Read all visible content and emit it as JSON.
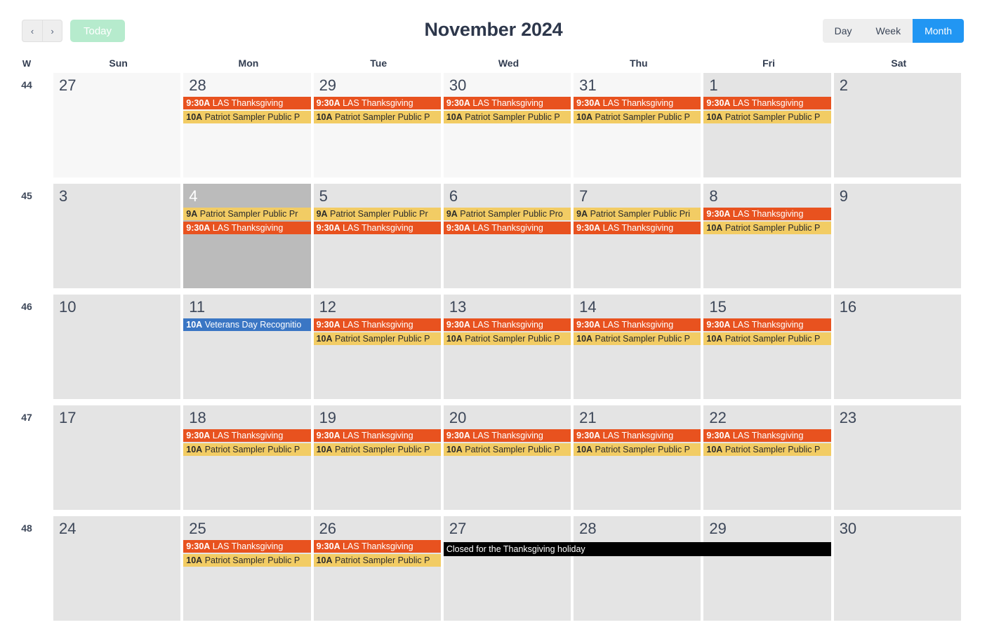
{
  "toolbar": {
    "prev_icon": "chevron-left-icon",
    "prev_label": "‹",
    "next_icon": "chevron-right-icon",
    "next_label": "›",
    "today_label": "Today",
    "title": "November 2024",
    "views": [
      {
        "label": "Day",
        "active": false
      },
      {
        "label": "Week",
        "active": false
      },
      {
        "label": "Month",
        "active": true
      }
    ]
  },
  "colors": {
    "accent_blue": "#2196f3",
    "today_green": "#b6ebcd",
    "event_orange": "#e8521f",
    "event_amber": "#f2cc64",
    "event_blue": "#3a76c4",
    "banner_black": "#000000",
    "cell_current": "#e4e4e4",
    "cell_other": "#f7f7f7",
    "cell_today": "#bbbbbb"
  },
  "header": {
    "week_col_label": "W",
    "days": [
      "Sun",
      "Mon",
      "Tue",
      "Wed",
      "Thu",
      "Fri",
      "Sat"
    ]
  },
  "weeks": [
    {
      "week_number": "44",
      "days": [
        {
          "num": "27",
          "other_month": true,
          "today": false,
          "events": []
        },
        {
          "num": "28",
          "other_month": true,
          "today": false,
          "events": [
            {
              "time": "9:30A",
              "title": "LAS Thanksgiving",
              "color": "orange"
            },
            {
              "time": "10A",
              "title": "Patriot Sampler Public P",
              "color": "amber"
            }
          ]
        },
        {
          "num": "29",
          "other_month": true,
          "today": false,
          "events": [
            {
              "time": "9:30A",
              "title": "LAS Thanksgiving",
              "color": "orange"
            },
            {
              "time": "10A",
              "title": "Patriot Sampler Public P",
              "color": "amber"
            }
          ]
        },
        {
          "num": "30",
          "other_month": true,
          "today": false,
          "events": [
            {
              "time": "9:30A",
              "title": "LAS Thanksgiving",
              "color": "orange"
            },
            {
              "time": "10A",
              "title": "Patriot Sampler Public P",
              "color": "amber"
            }
          ]
        },
        {
          "num": "31",
          "other_month": true,
          "today": false,
          "events": [
            {
              "time": "9:30A",
              "title": "LAS Thanksgiving",
              "color": "orange"
            },
            {
              "time": "10A",
              "title": "Patriot Sampler Public P",
              "color": "amber"
            }
          ]
        },
        {
          "num": "1",
          "other_month": false,
          "today": false,
          "events": [
            {
              "time": "9:30A",
              "title": "LAS Thanksgiving",
              "color": "orange"
            },
            {
              "time": "10A",
              "title": "Patriot Sampler Public P",
              "color": "amber"
            }
          ]
        },
        {
          "num": "2",
          "other_month": false,
          "today": false,
          "events": []
        }
      ]
    },
    {
      "week_number": "45",
      "days": [
        {
          "num": "3",
          "other_month": false,
          "today": false,
          "events": []
        },
        {
          "num": "4",
          "other_month": false,
          "today": true,
          "events": [
            {
              "time": "9A",
              "title": "Patriot Sampler Public Pr",
              "color": "amber"
            },
            {
              "time": "9:30A",
              "title": "LAS Thanksgiving",
              "color": "orange"
            }
          ]
        },
        {
          "num": "5",
          "other_month": false,
          "today": false,
          "events": [
            {
              "time": "9A",
              "title": "Patriot Sampler Public Pr",
              "color": "amber"
            },
            {
              "time": "9:30A",
              "title": "LAS Thanksgiving",
              "color": "orange"
            }
          ]
        },
        {
          "num": "6",
          "other_month": false,
          "today": false,
          "events": [
            {
              "time": "9A",
              "title": "Patriot Sampler Public Pro",
              "color": "amber"
            },
            {
              "time": "9:30A",
              "title": "LAS Thanksgiving",
              "color": "orange"
            }
          ]
        },
        {
          "num": "7",
          "other_month": false,
          "today": false,
          "events": [
            {
              "time": "9A",
              "title": "Patriot Sampler Public Pri",
              "color": "amber"
            },
            {
              "time": "9:30A",
              "title": "LAS Thanksgiving",
              "color": "orange"
            }
          ]
        },
        {
          "num": "8",
          "other_month": false,
          "today": false,
          "events": [
            {
              "time": "9:30A",
              "title": "LAS Thanksgiving",
              "color": "orange"
            },
            {
              "time": "10A",
              "title": "Patriot Sampler Public P",
              "color": "amber"
            }
          ]
        },
        {
          "num": "9",
          "other_month": false,
          "today": false,
          "events": []
        }
      ]
    },
    {
      "week_number": "46",
      "days": [
        {
          "num": "10",
          "other_month": false,
          "today": false,
          "events": []
        },
        {
          "num": "11",
          "other_month": false,
          "today": false,
          "events": [
            {
              "time": "10A",
              "title": "Veterans Day Recognitio",
              "color": "blue"
            }
          ]
        },
        {
          "num": "12",
          "other_month": false,
          "today": false,
          "events": [
            {
              "time": "9:30A",
              "title": "LAS Thanksgiving",
              "color": "orange"
            },
            {
              "time": "10A",
              "title": "Patriot Sampler Public P",
              "color": "amber"
            }
          ]
        },
        {
          "num": "13",
          "other_month": false,
          "today": false,
          "events": [
            {
              "time": "9:30A",
              "title": "LAS Thanksgiving",
              "color": "orange"
            },
            {
              "time": "10A",
              "title": "Patriot Sampler Public P",
              "color": "amber"
            }
          ]
        },
        {
          "num": "14",
          "other_month": false,
          "today": false,
          "events": [
            {
              "time": "9:30A",
              "title": "LAS Thanksgiving",
              "color": "orange"
            },
            {
              "time": "10A",
              "title": "Patriot Sampler Public P",
              "color": "amber"
            }
          ]
        },
        {
          "num": "15",
          "other_month": false,
          "today": false,
          "events": [
            {
              "time": "9:30A",
              "title": "LAS Thanksgiving",
              "color": "orange"
            },
            {
              "time": "10A",
              "title": "Patriot Sampler Public P",
              "color": "amber"
            }
          ]
        },
        {
          "num": "16",
          "other_month": false,
          "today": false,
          "events": []
        }
      ]
    },
    {
      "week_number": "47",
      "days": [
        {
          "num": "17",
          "other_month": false,
          "today": false,
          "events": []
        },
        {
          "num": "18",
          "other_month": false,
          "today": false,
          "events": [
            {
              "time": "9:30A",
              "title": "LAS Thanksgiving",
              "color": "orange"
            },
            {
              "time": "10A",
              "title": "Patriot Sampler Public P",
              "color": "amber"
            }
          ]
        },
        {
          "num": "19",
          "other_month": false,
          "today": false,
          "events": [
            {
              "time": "9:30A",
              "title": "LAS Thanksgiving",
              "color": "orange"
            },
            {
              "time": "10A",
              "title": "Patriot Sampler Public P",
              "color": "amber"
            }
          ]
        },
        {
          "num": "20",
          "other_month": false,
          "today": false,
          "events": [
            {
              "time": "9:30A",
              "title": "LAS Thanksgiving",
              "color": "orange"
            },
            {
              "time": "10A",
              "title": "Patriot Sampler Public P",
              "color": "amber"
            }
          ]
        },
        {
          "num": "21",
          "other_month": false,
          "today": false,
          "events": [
            {
              "time": "9:30A",
              "title": "LAS Thanksgiving",
              "color": "orange"
            },
            {
              "time": "10A",
              "title": "Patriot Sampler Public P",
              "color": "amber"
            }
          ]
        },
        {
          "num": "22",
          "other_month": false,
          "today": false,
          "events": [
            {
              "time": "9:30A",
              "title": "LAS Thanksgiving",
              "color": "orange"
            },
            {
              "time": "10A",
              "title": "Patriot Sampler Public P",
              "color": "amber"
            }
          ]
        },
        {
          "num": "23",
          "other_month": false,
          "today": false,
          "events": []
        }
      ]
    },
    {
      "week_number": "48",
      "days": [
        {
          "num": "24",
          "other_month": false,
          "today": false,
          "events": []
        },
        {
          "num": "25",
          "other_month": false,
          "today": false,
          "events": [
            {
              "time": "9:30A",
              "title": "LAS Thanksgiving",
              "color": "orange"
            },
            {
              "time": "10A",
              "title": "Patriot Sampler Public P",
              "color": "amber"
            }
          ]
        },
        {
          "num": "26",
          "other_month": false,
          "today": false,
          "events": [
            {
              "time": "9:30A",
              "title": "LAS Thanksgiving",
              "color": "orange"
            },
            {
              "time": "10A",
              "title": "Patriot Sampler Public P",
              "color": "amber"
            }
          ]
        },
        {
          "num": "27",
          "other_month": false,
          "today": false,
          "events": []
        },
        {
          "num": "28",
          "other_month": false,
          "today": false,
          "events": []
        },
        {
          "num": "29",
          "other_month": false,
          "today": false,
          "events": []
        },
        {
          "num": "30",
          "other_month": false,
          "today": false,
          "events": []
        }
      ],
      "banner": {
        "label": "Closed for the Thanksgiving holiday",
        "start_day_index": 3,
        "span_days": 3
      }
    }
  ]
}
